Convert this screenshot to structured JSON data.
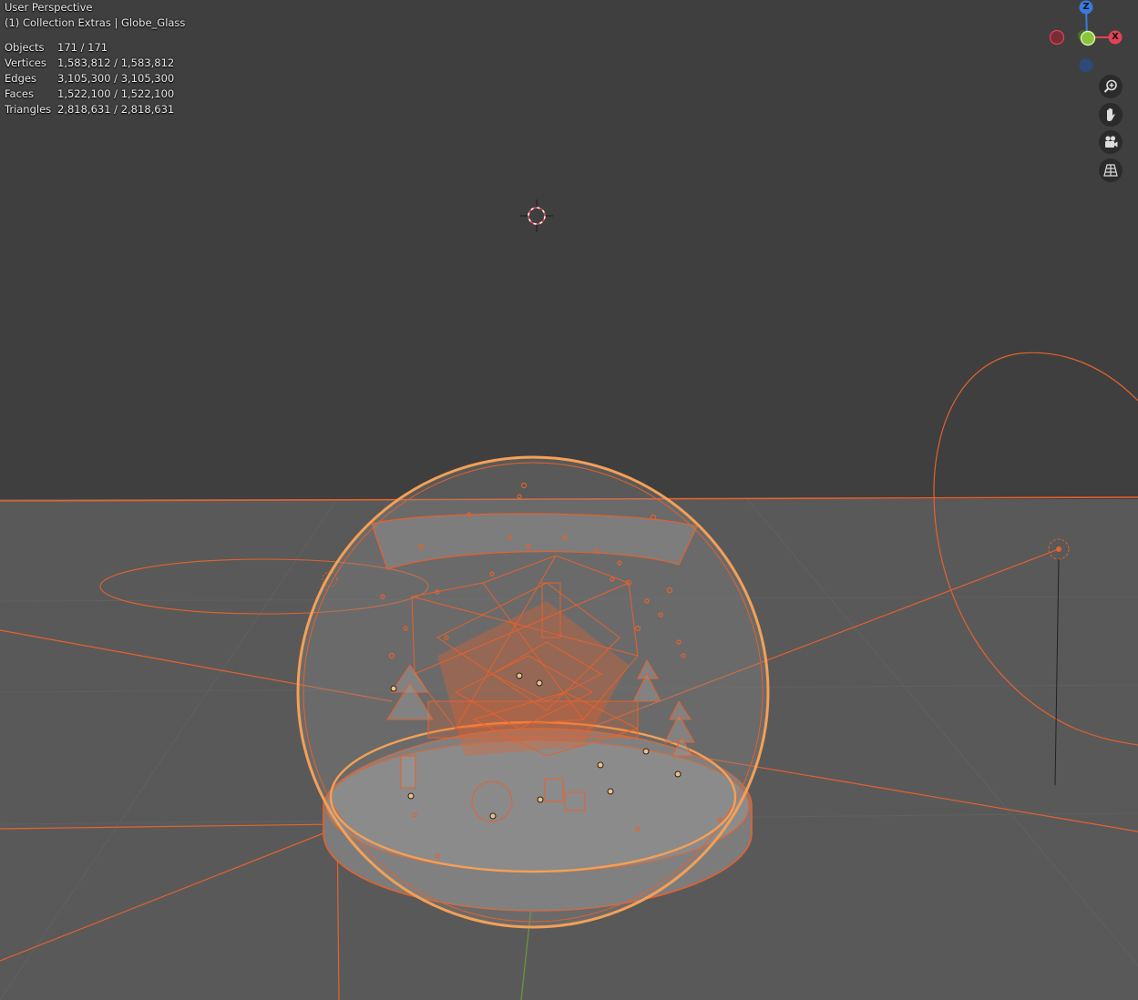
{
  "viewport": {
    "view_mode": "User Perspective",
    "active_collection": "(1) Collection Extras | Globe_Glass"
  },
  "stats": [
    {
      "label": "Objects",
      "value": "171 / 171"
    },
    {
      "label": "Vertices",
      "value": "1,583,812 / 1,583,812"
    },
    {
      "label": "Edges",
      "value": "3,105,300 / 3,105,300"
    },
    {
      "label": "Faces",
      "value": "1,522,100 / 1,522,100"
    },
    {
      "label": "Triangles",
      "value": "2,818,631 / 2,818,631"
    }
  ],
  "gizmo": {
    "z_label": "Z",
    "x_label": "X",
    "x_color": "#e04454",
    "y_color": "#8ac43a",
    "z_color": "#3a7ae0"
  },
  "nav_tools": [
    {
      "name": "zoom-icon"
    },
    {
      "name": "pan-hand-icon"
    },
    {
      "name": "camera-icon"
    },
    {
      "name": "orthographic-grid-icon"
    }
  ],
  "colors": {
    "background": "#3f3f3f",
    "floor": "#5a5a5a",
    "selection": "#e4622d",
    "active_selection": "#f5a055"
  }
}
